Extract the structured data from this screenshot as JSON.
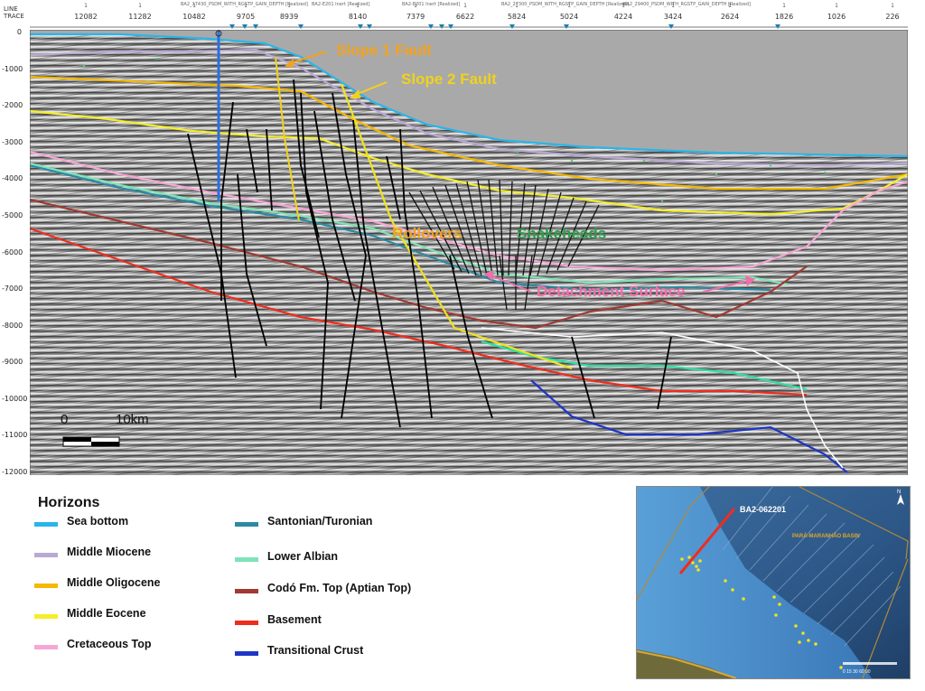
{
  "header": {
    "line_label": "LINE",
    "trace_label": "TRACE",
    "trace_values": [
      "12082",
      "11282",
      "10482",
      "9705",
      "8939",
      "8140",
      "7379",
      "6622",
      "5824",
      "5024",
      "4224",
      "3424",
      "2624",
      "1826",
      "1026",
      "226"
    ],
    "line_values": [
      "1",
      "1",
      "1",
      "1",
      "1",
      "1",
      "1",
      "1",
      "1",
      "1",
      "1",
      "1",
      "1",
      "1",
      "1",
      "1"
    ],
    "notes": [
      "BA2_17430_PSDM_WITH_RGSTP_GAIN_DEPTH [Realized]",
      "BA2-E201 Inert [Realized]",
      "BA2-E201 Inert [Realized]",
      "BA2_27300_PSDM_WITH_RGSTP_GAIN_DEPTH [Realized]",
      "BA2_29400_PSDM_WITH_RGSTP_GAIN_DEPTH [Realized]"
    ]
  },
  "depth_axis": {
    "ticks": [
      "0",
      "-1000",
      "-2000",
      "-3000",
      "-4000",
      "-5000",
      "-6000",
      "-7000",
      "-8000",
      "-9000",
      "-10000",
      "-11000",
      "-12000"
    ]
  },
  "annotations": {
    "slope1": "Slope 1 Fault",
    "slope2": "Slope 2 Fault",
    "rollovers": "Rollovers",
    "snakeheads": "Snakeheads",
    "detachment": "Detachment Surface"
  },
  "annotation_colors": {
    "slope": "#f4a21c",
    "slope2": "#f0d21c",
    "rollovers": "#f0a020",
    "snakeheads": "#2e9a4a",
    "detachment": "#f06fa8"
  },
  "scale_bar": {
    "zero_label": "0",
    "km_label": "10km"
  },
  "legend": {
    "title": "Horizons",
    "items": [
      {
        "label": "Sea bottom",
        "color": "#29b5ea"
      },
      {
        "label": "Middle Miocene",
        "color": "#b9a9d4"
      },
      {
        "label": "Middle Oligocene",
        "color": "#f5b800"
      },
      {
        "label": "Middle Eocene",
        "color": "#f5ee2a"
      },
      {
        "label": "Cretaceous Top",
        "color": "#f7a7d6"
      },
      {
        "label": "Santonian/Turonian",
        "color": "#2c8aa3"
      },
      {
        "label": "Lower Albian",
        "color": "#7fe3b8"
      },
      {
        "label": "Codó Fm. Top (Aptian Top)",
        "color": "#a03a32"
      },
      {
        "label": "Basement",
        "color": "#ee2d1e"
      },
      {
        "label": "Transitional Crust",
        "color": "#1d36c8"
      }
    ]
  },
  "map": {
    "line_label": "BA2-062201",
    "basin_label": "PARÁ-MARANHÃO BASIN",
    "north_label": "N",
    "scale_text": "0  15  30     60      90"
  }
}
